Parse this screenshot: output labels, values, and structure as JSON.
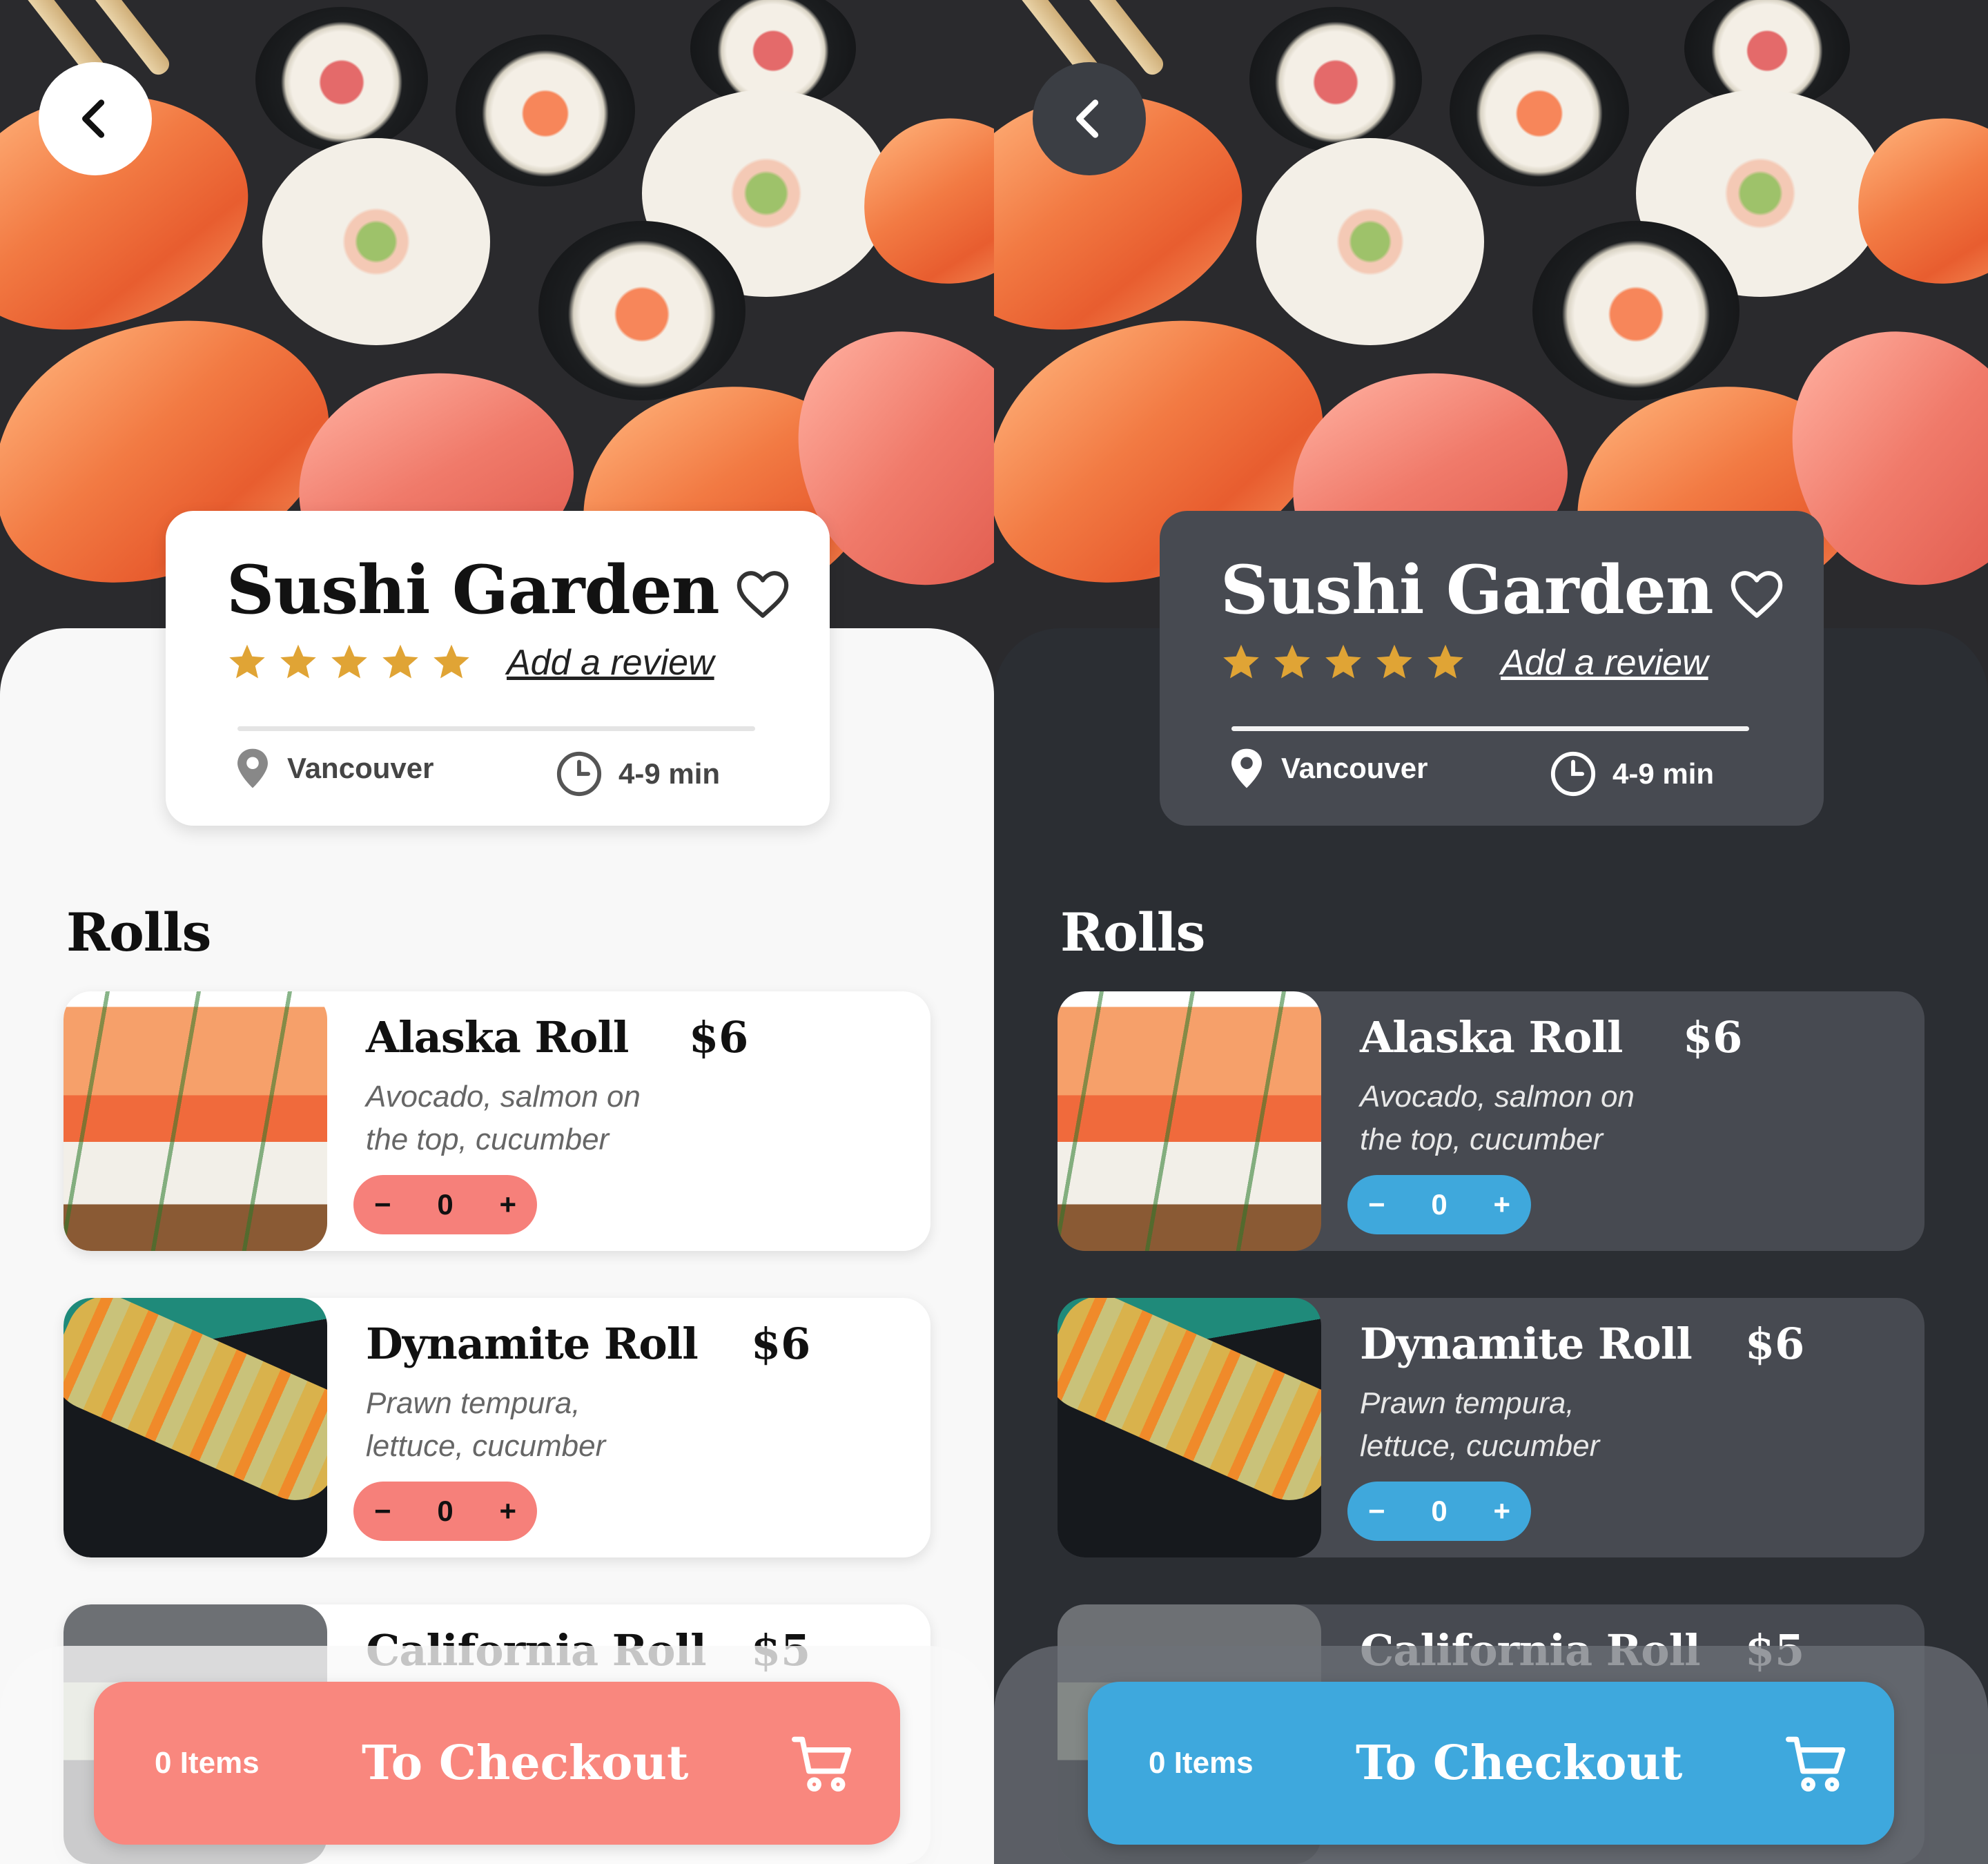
{
  "restaurant": {
    "name": "Sushi Garden",
    "rating": 5,
    "review_link": "Add a review",
    "location": "Vancouver",
    "delivery_time": "4-9 min"
  },
  "section": {
    "title": "Rolls"
  },
  "menu": [
    {
      "name": "Alaska Roll",
      "price": "$6",
      "desc_line1": "Avocado, salmon on",
      "desc_line2": "the top, cucumber",
      "quantity": "0"
    },
    {
      "name": "Dynamite Roll",
      "price": "$6",
      "desc_line1": "Prawn tempura,",
      "desc_line2": "lettuce, cucumber",
      "quantity": "0"
    },
    {
      "name": "California Roll",
      "price": "$5"
    }
  ],
  "stepper": {
    "minus": "−",
    "plus": "+"
  },
  "checkout": {
    "items": "0 Items",
    "label": "To Checkout"
  },
  "theme": {
    "light_accent": "#f6807a",
    "dark_accent": "#3fa8dc",
    "star_color": "#e0a435"
  },
  "icons": [
    "back-chevron-icon",
    "heart-icon",
    "star-icon",
    "location-pin-icon",
    "clock-icon",
    "cart-icon"
  ]
}
